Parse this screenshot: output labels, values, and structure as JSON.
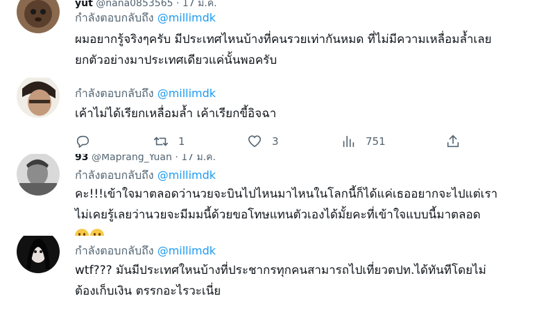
{
  "tweets": [
    {
      "header_name": "yut",
      "header_handle": "@nana0853565",
      "header_date": "· 17 มี.ค.",
      "replying_prefix": "กำลังตอบกลับถึง",
      "replying_mention": "@millimdk",
      "lines": [
        "ผมอยากรู้จริงๆครับ มีประเทศไหนบ้างที่คนรวยเท่ากันหมด  ที่ไม่มีความเหลื่อมล้ำเลย",
        "ยกตัวอย่างมาประเทศเดียวแค่นั้นพอครับ"
      ]
    },
    {
      "replying_prefix": "กำลังตอบกลับถึง",
      "replying_mention": "@millimdk",
      "lines": [
        "เค้าไม่ได้เรียกเหลื่อมล้ำ เค้าเรียกขี้อิจฉา"
      ],
      "actions": {
        "reply_count": "",
        "retweet_count": "1",
        "like_count": "3",
        "view_count": "751"
      }
    },
    {
      "header_name": "93",
      "header_handle": "@Maprang_Yuan",
      "header_date": "· 17 มี.ค.",
      "replying_prefix": "กำลังตอบกลับถึง",
      "replying_mention": "@millimdk",
      "lines": [
        "คะ!!!เข้าใจมาตลอดว่านวยจะบินไปไหนมาไหนในโลกนี้ก็ได้แค่เธออยากจะไปแต่เรา",
        "ไม่เคยรู้เลยว่านวยจะมีมมนี้ด้วยขอโทษแทนตัวเองได้มั้ยคะที่เข้าใจแบบนี้มาตลอด"
      ]
    },
    {
      "replying_prefix": "กำลังตอบกลับถึง",
      "replying_mention": "@millimdk",
      "lines": [
        "wtf??? มันมีประเทศใหนบ้างที่ประชากรทุกคนสามารถไปเที่ยวตปท.ได้ทันทีโดยไม่",
        "ต้องเก็บเงิน ตรรกอะไรวะเนี่ย"
      ]
    }
  ]
}
